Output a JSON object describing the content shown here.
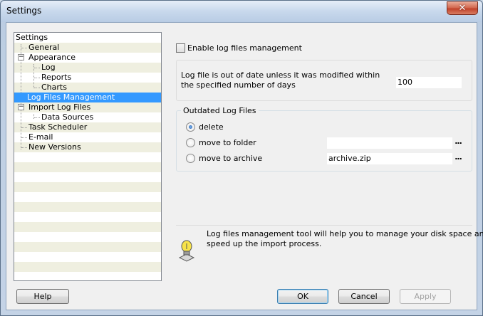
{
  "window": {
    "title": "Settings",
    "close_glyph": "✕"
  },
  "tree": {
    "items": [
      {
        "label": "Settings",
        "level": 0
      },
      {
        "label": "General",
        "level": 1
      },
      {
        "label": "Appearance",
        "level": 1,
        "expander": "−"
      },
      {
        "label": "Log",
        "level": 2
      },
      {
        "label": "Reports",
        "level": 2
      },
      {
        "label": "Charts",
        "level": 2
      },
      {
        "label": "Log Files Management",
        "level": 1,
        "selected": true
      },
      {
        "label": "Import Log Files",
        "level": 1,
        "expander": "−"
      },
      {
        "label": "Data Sources",
        "level": 2
      },
      {
        "label": "Task Scheduler",
        "level": 1
      },
      {
        "label": "E-mail",
        "level": 1
      },
      {
        "label": "New Versions",
        "level": 1
      }
    ]
  },
  "main": {
    "enable_label": "Enable log files management",
    "enable_checked": false,
    "outofdate_text_1": "Log file is out of date unless it was modified within",
    "outofdate_text_2": "the specified number of days",
    "days_value": "100",
    "outdated_group_title": "Outdated Log Files",
    "radio_delete": "delete",
    "radio_move_folder": "move to folder",
    "radio_move_archive": "move to archive",
    "folder_value": "",
    "archive_value": "archive.zip",
    "browse_glyph": "...",
    "info_text_1": "Log files management tool will help you to manage your disk space and",
    "info_text_2": "speed up the import process."
  },
  "buttons": {
    "help": "Help",
    "ok": "OK",
    "cancel": "Cancel",
    "apply": "Apply"
  },
  "icons": {
    "close": "close-icon",
    "info": "lightbulb-icon"
  }
}
